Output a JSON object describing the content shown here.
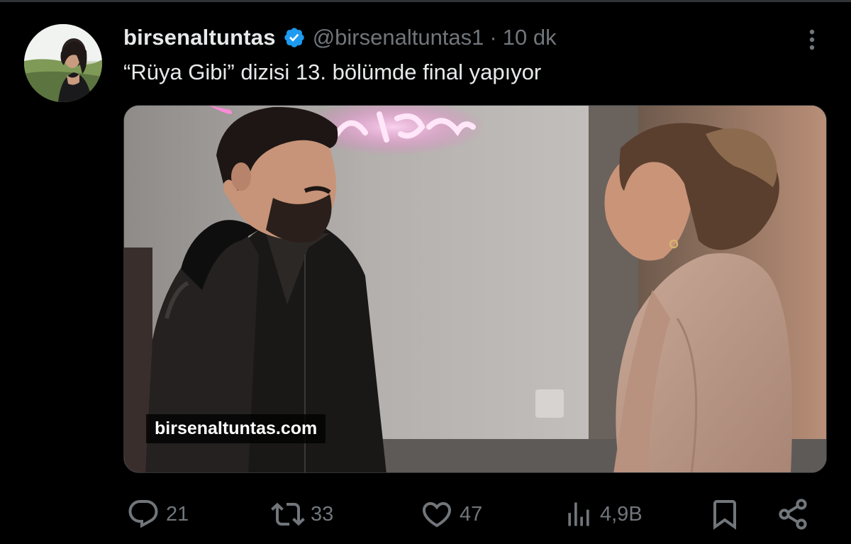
{
  "tweet": {
    "author": {
      "display_name": "birsenaltuntas",
      "handle": "@birsenaltuntas1",
      "verified": true
    },
    "separator": "·",
    "time": "10 dk",
    "text": "“Rüya Gibi” dizisi 13. bölümde final yapıyor",
    "media": {
      "watermark": "birsenaltuntas.com"
    },
    "actions": {
      "reply": {
        "icon": "reply-icon",
        "count": "21"
      },
      "retweet": {
        "icon": "retweet-icon",
        "count": "33"
      },
      "like": {
        "icon": "heart-icon",
        "count": "47"
      },
      "views": {
        "icon": "analytics-icon",
        "count": "4,9B"
      },
      "bookmark": {
        "icon": "bookmark-icon"
      },
      "share": {
        "icon": "share-icon"
      }
    }
  },
  "colors": {
    "background": "#000000",
    "text": "#e7e9ea",
    "secondary_text": "#71767b",
    "verified_badge": "#1d9bf0",
    "divider": "#2f3336"
  }
}
